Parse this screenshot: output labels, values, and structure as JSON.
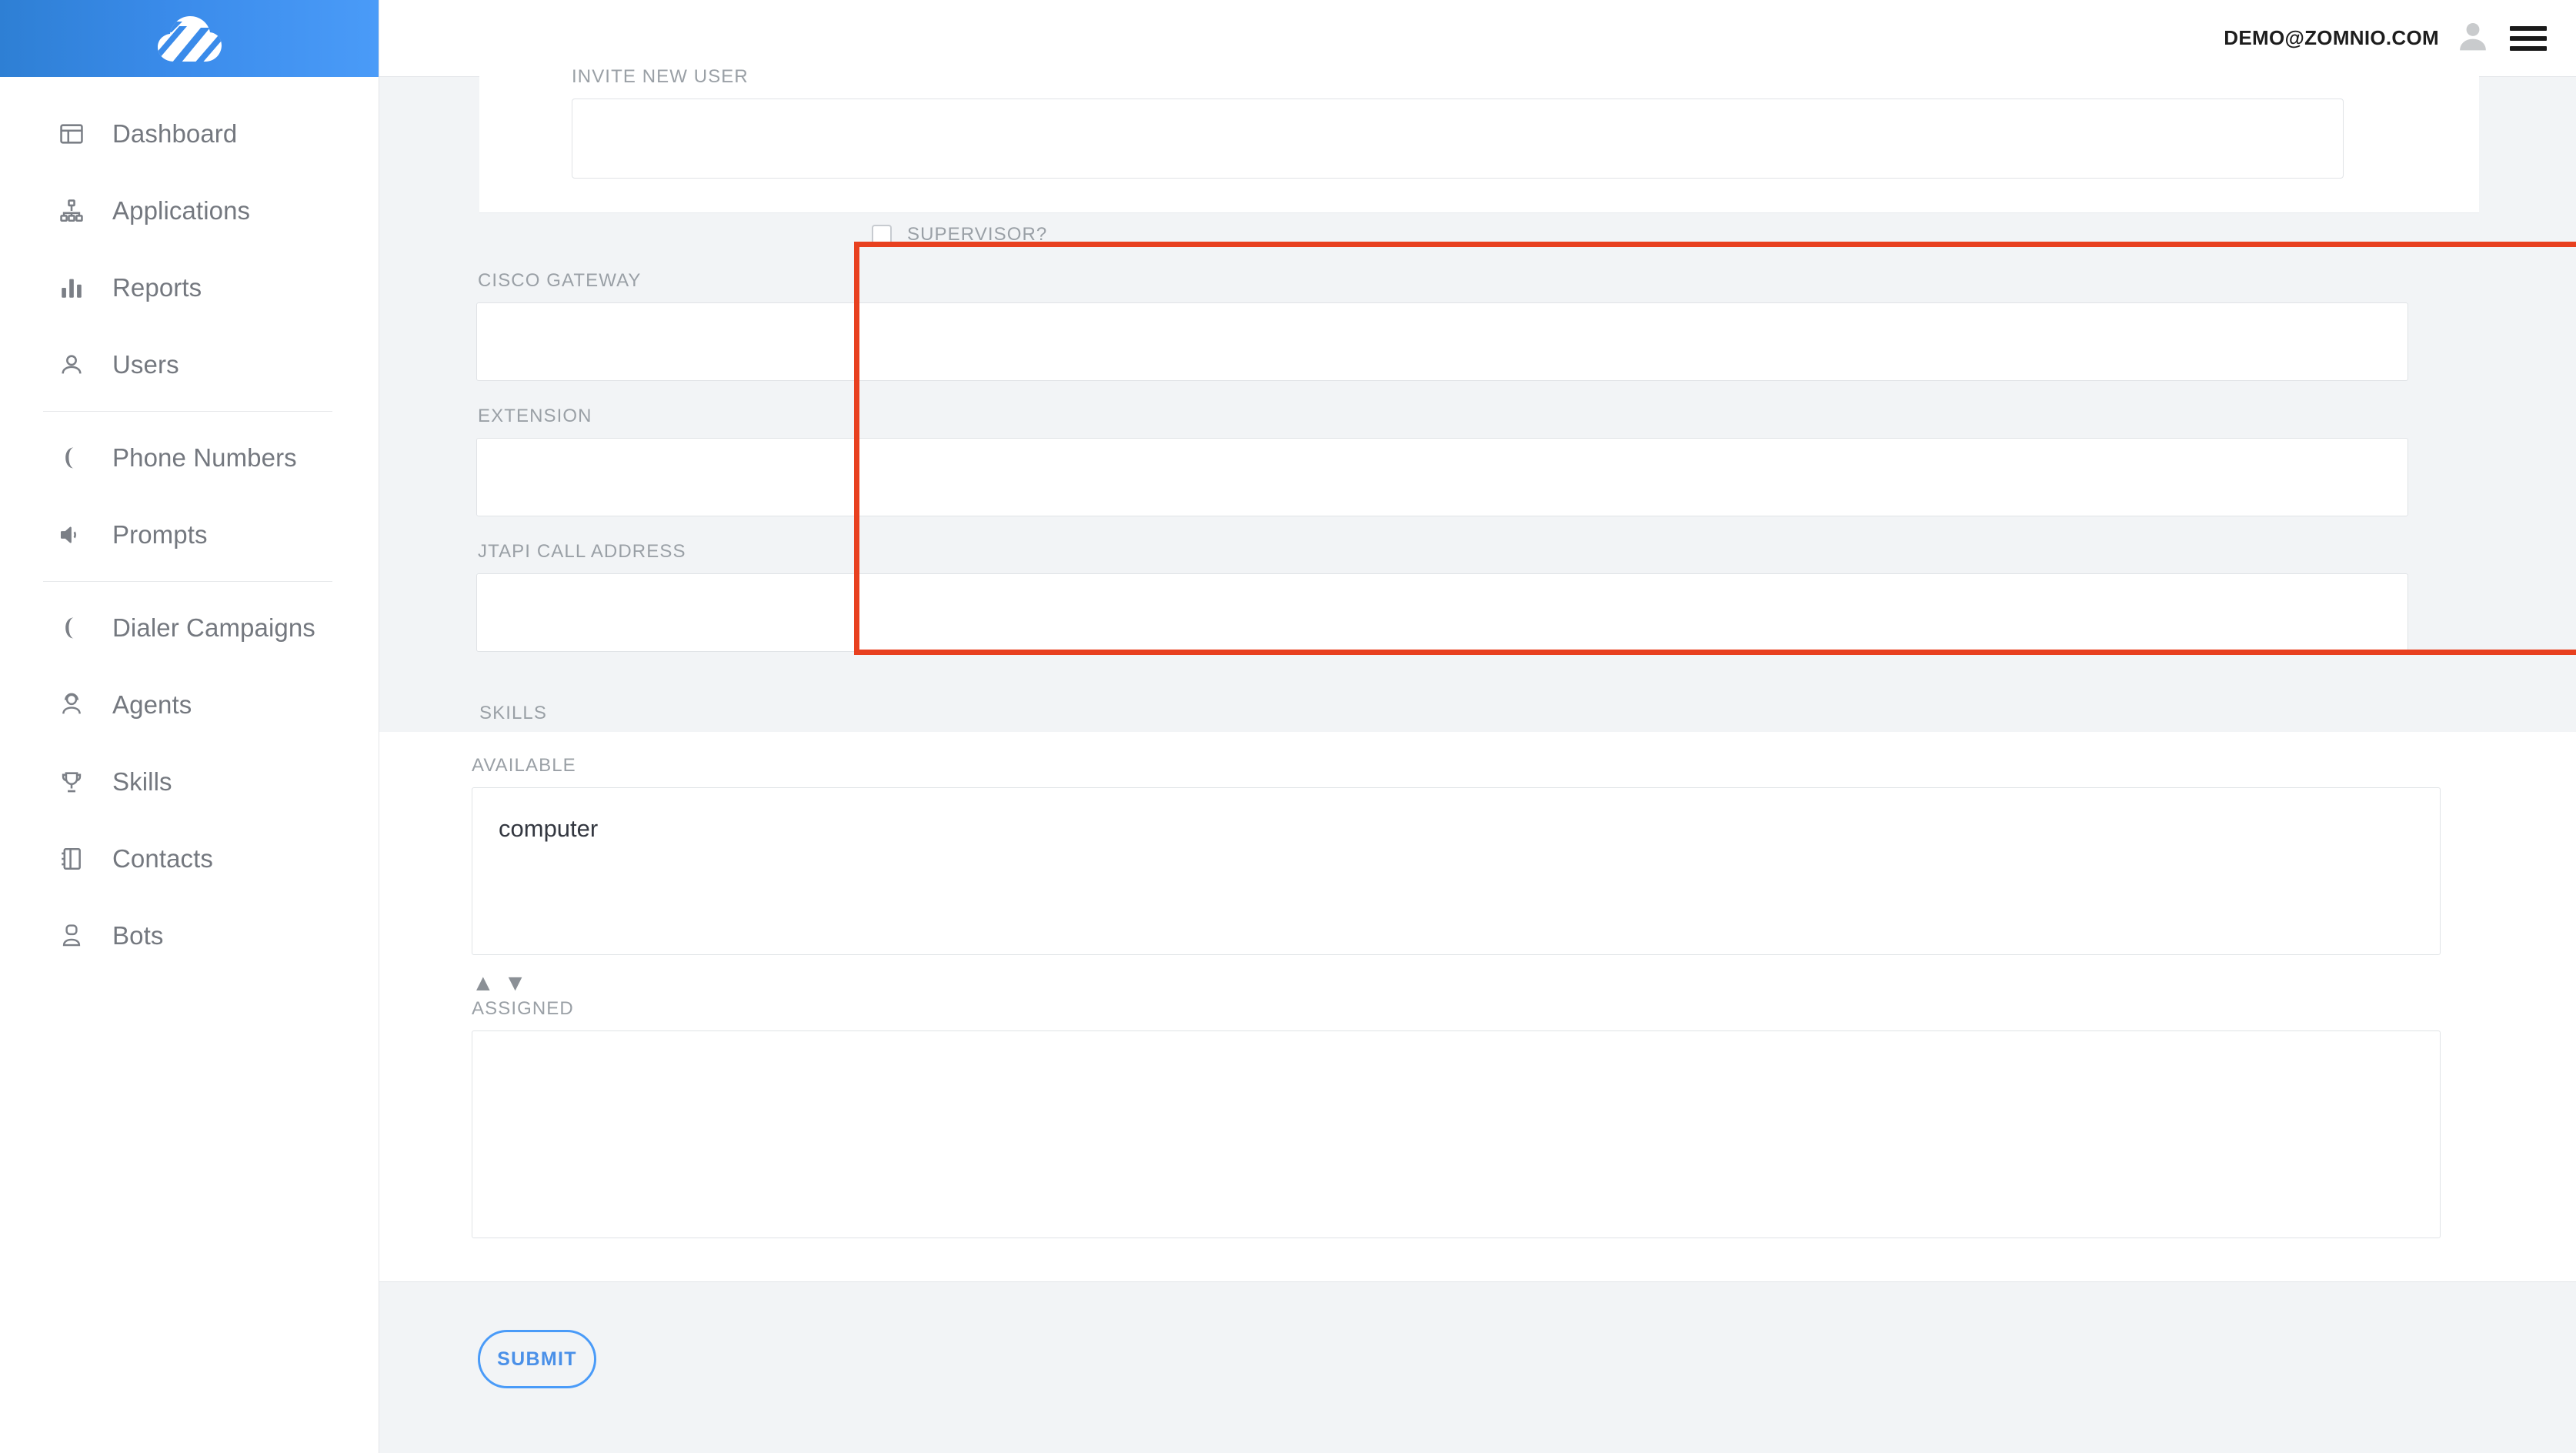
{
  "brand": {
    "logo_icon": "cloud-logo-icon",
    "header_gradient_start": "#2e7fd4",
    "header_gradient_end": "#4a9bf8"
  },
  "topbar": {
    "user_email": "DEMO@ZOMNIO.COM",
    "avatar_icon": "user-avatar-icon",
    "menu_icon": "hamburger-menu-icon"
  },
  "sidebar": {
    "groups": [
      {
        "items": [
          {
            "label": "Dashboard",
            "icon": "dashboard-icon"
          },
          {
            "label": "Applications",
            "icon": "sitemap-icon"
          },
          {
            "label": "Reports",
            "icon": "bar-chart-icon"
          },
          {
            "label": "Users",
            "icon": "user-icon"
          }
        ]
      },
      {
        "items": [
          {
            "label": "Phone Numbers",
            "icon": "phone-icon"
          },
          {
            "label": "Prompts",
            "icon": "speaker-icon"
          }
        ]
      },
      {
        "items": [
          {
            "label": "Dialer Campaigns",
            "icon": "phone-icon"
          },
          {
            "label": "Agents",
            "icon": "agent-headset-icon"
          },
          {
            "label": "Skills",
            "icon": "trophy-icon"
          },
          {
            "label": "Contacts",
            "icon": "address-book-icon"
          },
          {
            "label": "Bots",
            "icon": "bot-icon"
          }
        ]
      }
    ]
  },
  "form": {
    "invite": {
      "label": "INVITE NEW USER",
      "value": "",
      "placeholder": ""
    },
    "supervisor": {
      "label": "SUPERVISOR?",
      "checked": false
    },
    "highlight_color": "#e8401f",
    "gateway_fields": [
      {
        "label": "CISCO GATEWAY",
        "value": "",
        "placeholder": ""
      },
      {
        "label": "EXTENSION",
        "value": "",
        "placeholder": ""
      },
      {
        "label": "JTAPI CALL ADDRESS",
        "value": "",
        "placeholder": ""
      }
    ],
    "skills": {
      "label": "SKILLS",
      "available": {
        "label": "AVAILABLE",
        "items": [
          "computer"
        ]
      },
      "arrows": {
        "up_glyph": "▲",
        "down_glyph": "▼"
      },
      "assigned": {
        "label": "ASSIGNED",
        "items": []
      }
    },
    "submit_label": "SUBMIT",
    "submit_accent": "#4a9bf8"
  }
}
